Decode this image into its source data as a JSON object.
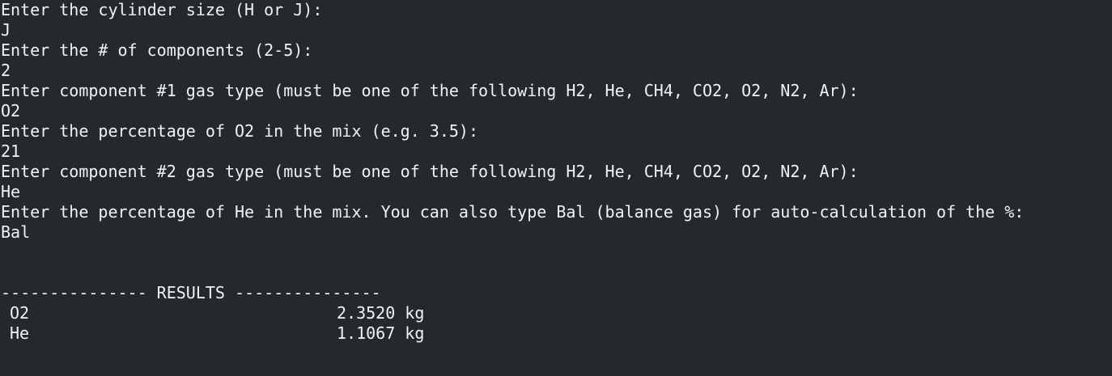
{
  "transcript": [
    "Enter the cylinder size (H or J):",
    "J",
    "Enter the # of components (2-5):",
    "2",
    "Enter component #1 gas type (must be one of the following H2, He, CH4, CO2, O2, N2, Ar):",
    "O2",
    "Enter the percentage of O2 in the mix (e.g. 3.5):",
    "21",
    "Enter component #2 gas type (must be one of the following H2, He, CH4, CO2, O2, N2, Ar):",
    "He",
    "Enter the percentage of He in the mix. You can also type Bal (balance gas) for auto-calculation of the %:",
    "Bal"
  ],
  "results": {
    "header": "--------------- RESULTS ---------------",
    "rows": [
      {
        "gas": "O2",
        "value": "2.3520 kg"
      },
      {
        "gas": "He",
        "value": "1.1067 kg"
      }
    ]
  }
}
